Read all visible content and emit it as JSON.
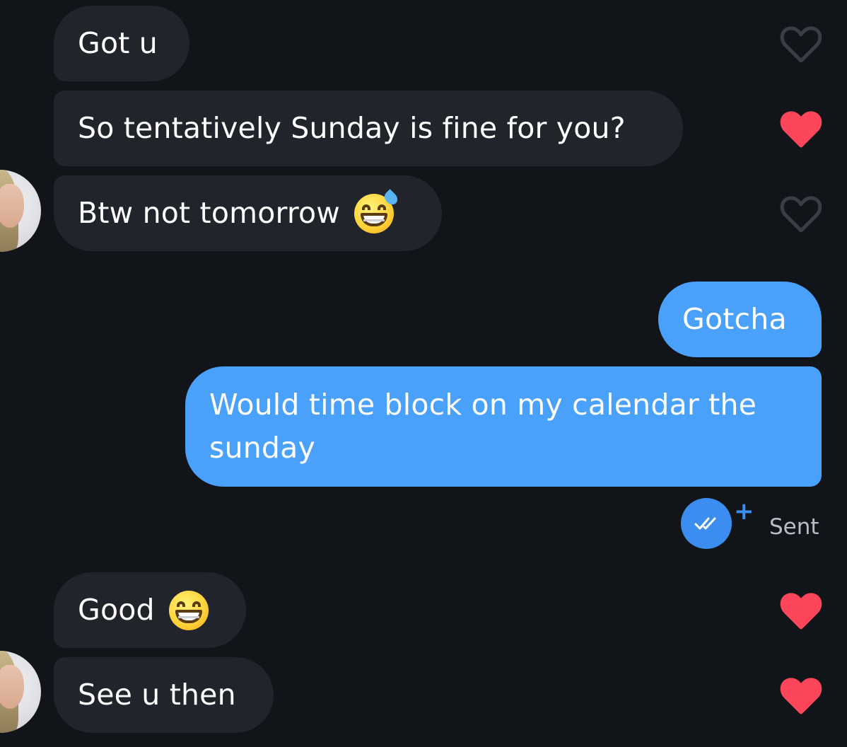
{
  "messages": [
    {
      "text": "Got u",
      "direction": "in",
      "liked": false
    },
    {
      "text": "So tentatively Sunday is fine for you?",
      "direction": "in",
      "liked": true
    },
    {
      "text": "Btw not tomorrow",
      "direction": "in",
      "emoji": "grinning-face-with-sweat",
      "liked": false
    },
    {
      "text": "Gotcha",
      "direction": "out"
    },
    {
      "line1": "Would time block on my calendar the",
      "line2": "sunday",
      "direction": "out"
    },
    {
      "text": "Good",
      "direction": "in",
      "emoji": "grinning-face-with-smiling-eyes",
      "liked": true
    },
    {
      "text": "See u then",
      "direction": "in",
      "liked": true
    }
  ],
  "status": {
    "label": "Sent",
    "plus": "+"
  },
  "colors": {
    "background": "#111419",
    "incoming_bubble": "#21242b",
    "outgoing_bubble": "#4aa1fc",
    "heart_liked": "#fd4659",
    "heart_outline": "#3a3d45",
    "status_blue": "#3b8ef0"
  }
}
